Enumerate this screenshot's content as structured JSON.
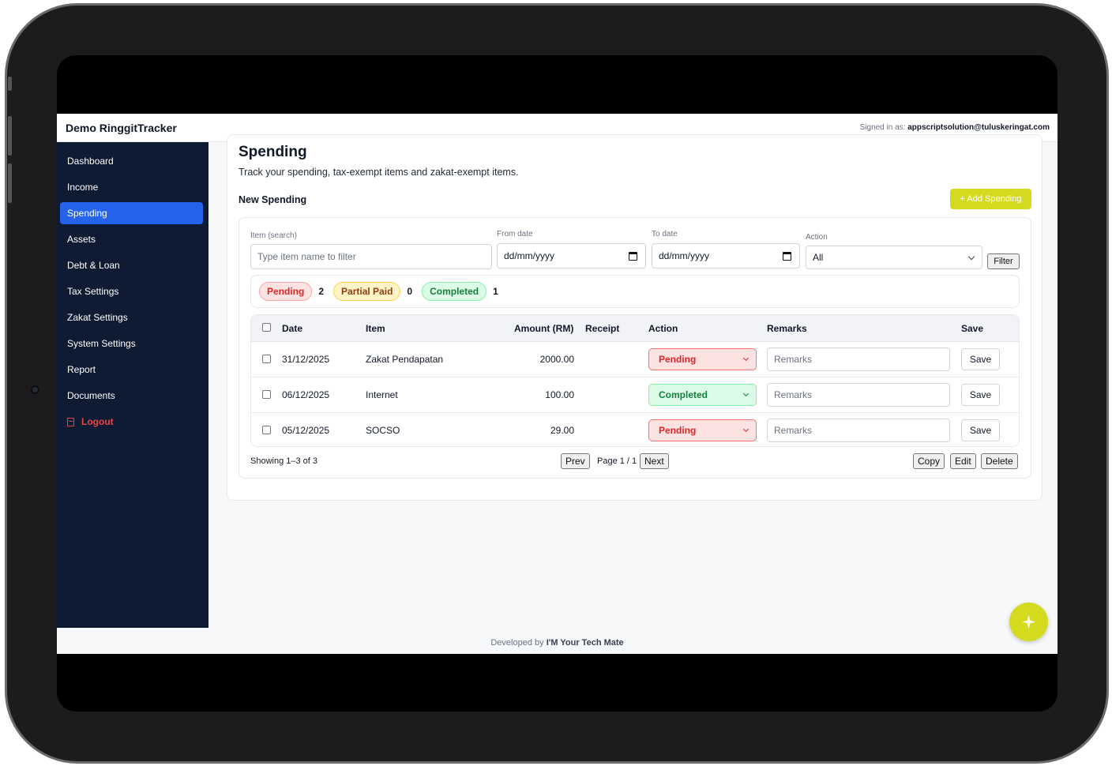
{
  "app": {
    "brand": "Demo RinggitTracker",
    "signed_label": "Signed in as:",
    "signed_email": "appscriptsolution@tuluskeringat.com"
  },
  "sidebar": {
    "items": [
      {
        "label": "Dashboard"
      },
      {
        "label": "Income"
      },
      {
        "label": "Spending"
      },
      {
        "label": "Assets"
      },
      {
        "label": "Debt & Loan"
      },
      {
        "label": "Tax Settings"
      },
      {
        "label": "Zakat Settings"
      },
      {
        "label": "System Settings"
      },
      {
        "label": "Report"
      },
      {
        "label": "Documents"
      },
      {
        "label": "Logout"
      }
    ],
    "active": "Spending"
  },
  "page": {
    "title": "Spending",
    "subtitle": "Track your spending, tax-exempt items and zakat-exempt items.",
    "section_title": "New Spending",
    "add_button": "+ Add Spending"
  },
  "filters": {
    "item_label": "Item (search)",
    "item_placeholder": "Type item name to filter",
    "from_label": "From date",
    "from_value": "dd/mm/yyyy",
    "to_label": "To date",
    "to_value": "dd/mm/yyyy",
    "action_label": "Action",
    "action_value": "All",
    "filter_button": "Filter"
  },
  "status_counts": {
    "pending_label": "Pending",
    "pending_count": "2",
    "partial_label": "Partial Paid",
    "partial_count": "0",
    "completed_label": "Completed",
    "completed_count": "1"
  },
  "table": {
    "headers": {
      "date": "Date",
      "item": "Item",
      "amount": "Amount (RM)",
      "receipt": "Receipt",
      "action": "Action",
      "remarks": "Remarks",
      "save": "Save"
    },
    "rows": [
      {
        "date": "31/12/2025",
        "item": "Zakat Pendapatan",
        "amount": "2000.00",
        "receipt": "",
        "action": "Pending",
        "remarks_placeholder": "Remarks",
        "save": "Save"
      },
      {
        "date": "06/12/2025",
        "item": "Internet",
        "amount": "100.00",
        "receipt": "",
        "action": "Completed",
        "remarks_placeholder": "Remarks",
        "save": "Save"
      },
      {
        "date": "05/12/2025",
        "item": "SOCSO",
        "amount": "29.00",
        "receipt": "",
        "action": "Pending",
        "remarks_placeholder": "Remarks",
        "save": "Save"
      }
    ]
  },
  "pagination": {
    "showing": "Showing 1–3 of 3",
    "prev": "Prev",
    "page": "Page 1 / 1",
    "next": "Next",
    "copy": "Copy",
    "edit": "Edit",
    "delete": "Delete"
  },
  "footer": {
    "prefix": "Developed by",
    "name": "I'M Your Tech Mate"
  },
  "colors": {
    "sidebar_bg": "#0f1a33",
    "active": "#2563eb",
    "accent": "#d4db1f",
    "pending": "#dc2626",
    "completed": "#15803d"
  },
  "icons": {
    "fab": "sparkle-icon",
    "logout": "logout-icon"
  }
}
